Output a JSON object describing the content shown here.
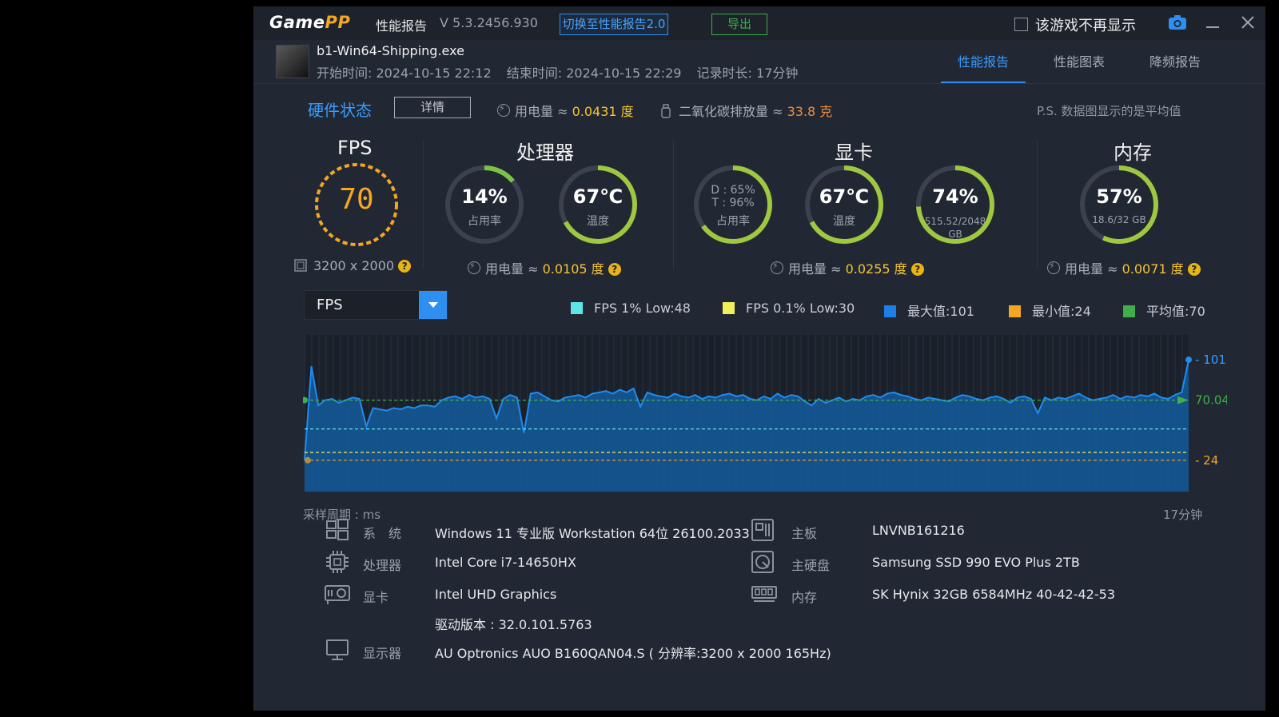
{
  "app": {
    "logo_game": "Game",
    "logo_pp": "PP",
    "title": "性能报告",
    "version": "V 5.3.2456.930",
    "switch_button": "切换至性能报告2.0",
    "export_button": "导出",
    "hide_checkbox_label": "该游戏不再显示"
  },
  "game": {
    "exe": "b1-Win64-Shipping.exe",
    "start_time": "开始时间: 2024-10-15 22:12",
    "end_time": "结束时间: 2024-10-15 22:29",
    "duration": "记录时长: 17分钟"
  },
  "tabs": [
    {
      "label": "性能报告",
      "active": true
    },
    {
      "label": "性能图表",
      "active": false
    },
    {
      "label": "降频报告",
      "active": false
    }
  ],
  "hardware": {
    "title": "硬件状态",
    "detail_button": "详情",
    "power_prefix": "用电量 ≈ ",
    "power_total": "0.0431 度",
    "co2_prefix": "二氧化碳排放量 ≈ ",
    "co2_value": "33.8 克",
    "note": "P.S. 数据图显示的是平均值"
  },
  "fps": {
    "title": "FPS",
    "value": "70",
    "resolution": "3200 x 2000",
    "ring_color": "#f5a623"
  },
  "cpu": {
    "title": "处理器",
    "usage": "14%",
    "usage_label": "占用率",
    "usage_fraction": 0.14,
    "temp": "67℃",
    "temp_label": "温度",
    "temp_fraction": 0.67,
    "power_prefix": "用电量 ≈ ",
    "power": "0.0105 度"
  },
  "gpu": {
    "title": "显卡",
    "usage_d": "D : 65%",
    "usage_t": "T : 96%",
    "usage_label": "占用率",
    "usage_fraction": 0.65,
    "temp": "67℃",
    "temp_label": "温度",
    "temp_fraction": 0.67,
    "mem": "74%",
    "mem_detail": "515.52/2048",
    "mem_unit": "GB",
    "mem_fraction": 0.74,
    "power_prefix": "用电量 ≈ ",
    "power": "0.0255 度"
  },
  "ram": {
    "title": "内存",
    "usage": "57%",
    "detail": "18.6/32 GB",
    "usage_fraction": 0.57,
    "power_prefix": "用电量 ≈ ",
    "power": "0.0071 度"
  },
  "chart_controls": {
    "metric": "FPS",
    "legend": [
      {
        "label": "FPS 1% Low:48",
        "color": "#5ee6e6"
      },
      {
        "label": "FPS 0.1% Low:30",
        "color": "#f2f05a"
      },
      {
        "label": "最大值:101",
        "color": "#1e7fe6"
      },
      {
        "label": "最小值:24",
        "color": "#f5a623"
      },
      {
        "label": "平均值:70",
        "color": "#3fae4b"
      }
    ],
    "sample_label": "采样周期 : ms",
    "duration_label": "17分钟"
  },
  "chart_data": {
    "type": "area",
    "title": "",
    "xlabel": "",
    "ylabel": "",
    "ylim": [
      0,
      120
    ],
    "max_label": "101",
    "avg_label": "70.04",
    "min_label": "24",
    "max": 101,
    "avg": 70.04,
    "min": 24,
    "low1": 48,
    "low01": 30,
    "series": [
      {
        "values": [
          24,
          96,
          66,
          70,
          71,
          68,
          70,
          72,
          71,
          50,
          64,
          63,
          62,
          64,
          63,
          65,
          64,
          66,
          66,
          65,
          70,
          72,
          73,
          71,
          74,
          72,
          73,
          71,
          56,
          71,
          74,
          72,
          45,
          75,
          76,
          73,
          70,
          69,
          72,
          73,
          74,
          72,
          75,
          76,
          77,
          75,
          78,
          76,
          79,
          65,
          76,
          74,
          73,
          72,
          75,
          73,
          72,
          74,
          71,
          73,
          72,
          74,
          75,
          73,
          74,
          71,
          70,
          73,
          71,
          75,
          72,
          74,
          73,
          69,
          66,
          71,
          68,
          70,
          72,
          69,
          71,
          70,
          73,
          74,
          72,
          75,
          76,
          74,
          73,
          71,
          70,
          72,
          71,
          70,
          69,
          72,
          74,
          73,
          71,
          70,
          72,
          73,
          71,
          68,
          72,
          73,
          71,
          60,
          72,
          70,
          72,
          71,
          73,
          75,
          72,
          70,
          71,
          72,
          74,
          71,
          73,
          72,
          74,
          73,
          75,
          72,
          71,
          74,
          76,
          101
        ]
      }
    ]
  },
  "sysinfo": [
    {
      "icon": "windows-icon",
      "label": "系　统",
      "value": "Windows 11 专业版 Workstation 64位 26100.2033"
    },
    {
      "icon": "motherboard-icon",
      "label": "主板",
      "value": "LNVNB161216"
    },
    {
      "icon": "cpu-icon",
      "label": "处理器",
      "value": "Intel Core i7-14650HX"
    },
    {
      "icon": "disk-icon",
      "label": "主硬盘",
      "value": "Samsung SSD 990 EVO Plus 2TB"
    },
    {
      "icon": "gpu-icon",
      "label": "显卡",
      "value": "Intel UHD Graphics"
    },
    {
      "icon": "ram-icon",
      "label": "内存",
      "value": "SK Hynix 32GB 6584MHz 40-42-42-53"
    },
    {
      "icon": "monitor-icon",
      "label": "显示器",
      "value": "AU Optronics AUO B160QAN04.S ( 分辨率:3200 x 2000 165Hz)"
    }
  ],
  "driver": "驱动版本 : 32.0.101.5763",
  "colors": {
    "accent": "#2f8ff0",
    "ring_track": "#3b424d",
    "ring_green": "#55b848",
    "ring_yellow": "#d7d24a",
    "chart_fill": "#135a9c",
    "chart_line": "#1e8cf0"
  }
}
